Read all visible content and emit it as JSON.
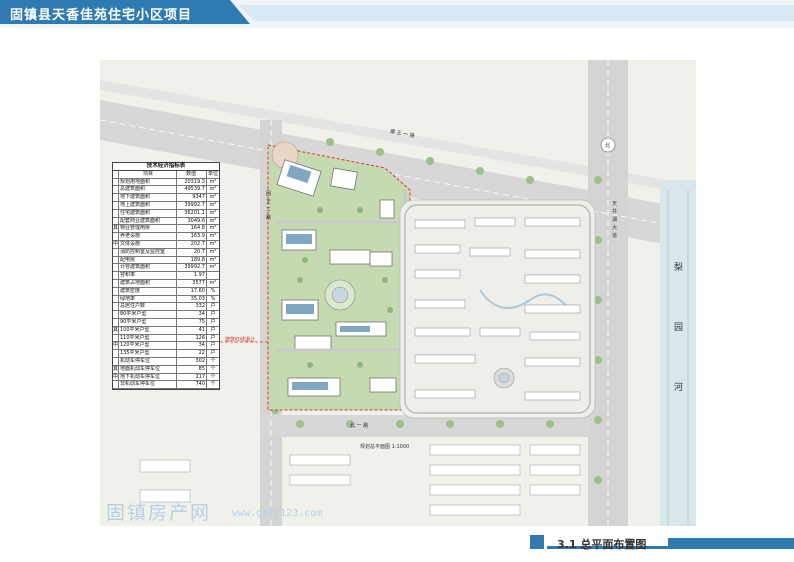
{
  "header": {
    "title": "固镇县天香佳苑住宅小区项目"
  },
  "table": {
    "title": "技术经济指标表",
    "columns": [
      "项目",
      "数值",
      "单位"
    ],
    "rows": [
      {
        "group": "",
        "name": "规划用地面积",
        "value": "20319.3",
        "unit": "m²"
      },
      {
        "group": "",
        "name": "总建筑面积",
        "value": "49539.7",
        "unit": "m²"
      },
      {
        "group": "",
        "name": "地下建筑面积",
        "value": "9347",
        "unit": "m²"
      },
      {
        "group": "",
        "name": "地上建筑面积",
        "value": "39992.7",
        "unit": "m²"
      },
      {
        "group": "",
        "name": "住宅建筑面积",
        "value": "36201.1",
        "unit": "m²"
      },
      {
        "group": "",
        "name": "配套商业建筑面积",
        "value": "3049.6",
        "unit": "m²"
      },
      {
        "group": "其",
        "name": "物业管理用房",
        "value": "164.8",
        "unit": "m²"
      },
      {
        "group": "",
        "name": "养老设施",
        "value": "163.9",
        "unit": "m²"
      },
      {
        "group": "中",
        "name": "文体设施",
        "value": "202.7",
        "unit": "m²"
      },
      {
        "group": "",
        "name": "消防控制室及监控室",
        "value": "20.7",
        "unit": "m²"
      },
      {
        "group": "",
        "name": "配电房",
        "value": "189.8",
        "unit": "m²"
      },
      {
        "group": "",
        "name": "计容建筑面积",
        "value": "39992.7",
        "unit": "m²"
      },
      {
        "group": "",
        "name": "容积率",
        "value": "1.97",
        "unit": ""
      },
      {
        "group": "",
        "name": "建筑占地面积",
        "value": "3577",
        "unit": "m²"
      },
      {
        "group": "",
        "name": "建筑密度",
        "value": "17.60",
        "unit": "%"
      },
      {
        "group": "",
        "name": "绿地率",
        "value": "35.03",
        "unit": "%"
      },
      {
        "group": "",
        "name": "总居住户数",
        "value": "332",
        "unit": "户"
      },
      {
        "group": "",
        "name": "80平米户型",
        "value": "34",
        "unit": "户"
      },
      {
        "group": "",
        "name": "90平米户型",
        "value": "75",
        "unit": "户"
      },
      {
        "group": "其",
        "name": "100平米户型",
        "value": "41",
        "unit": "户"
      },
      {
        "group": "",
        "name": "110平米户型",
        "value": "126",
        "unit": "户"
      },
      {
        "group": "中",
        "name": "120平米户型",
        "value": "34",
        "unit": "户"
      },
      {
        "group": "",
        "name": "135平米户型",
        "value": "22",
        "unit": "户"
      },
      {
        "group": "",
        "name": "机动车停车位",
        "value": "302",
        "unit": "个"
      },
      {
        "group": "其",
        "name": "地面机动车停车位",
        "value": "85",
        "unit": "个"
      },
      {
        "group": "中",
        "name": "地下机动车停车位",
        "value": "217",
        "unit": "个"
      },
      {
        "group": "",
        "name": "非机动车停车位",
        "value": "740",
        "unit": "个"
      }
    ]
  },
  "map_labels": {
    "north_road": "康 王 一 路",
    "east_road": "天 井 湖 大 道",
    "west_road": "固 王 二 路",
    "south_road": "北 一 路",
    "river": [
      "梨",
      "园",
      "河"
    ],
    "north_mark": "北",
    "site_note": "建筑红线退让",
    "scale_note": "规划总平面图 1:1000"
  },
  "watermark": {
    "text": "固镇房产网",
    "url": "www.gzfc123.com"
  },
  "footer": {
    "caption": "3.1  总平面布置图"
  }
}
